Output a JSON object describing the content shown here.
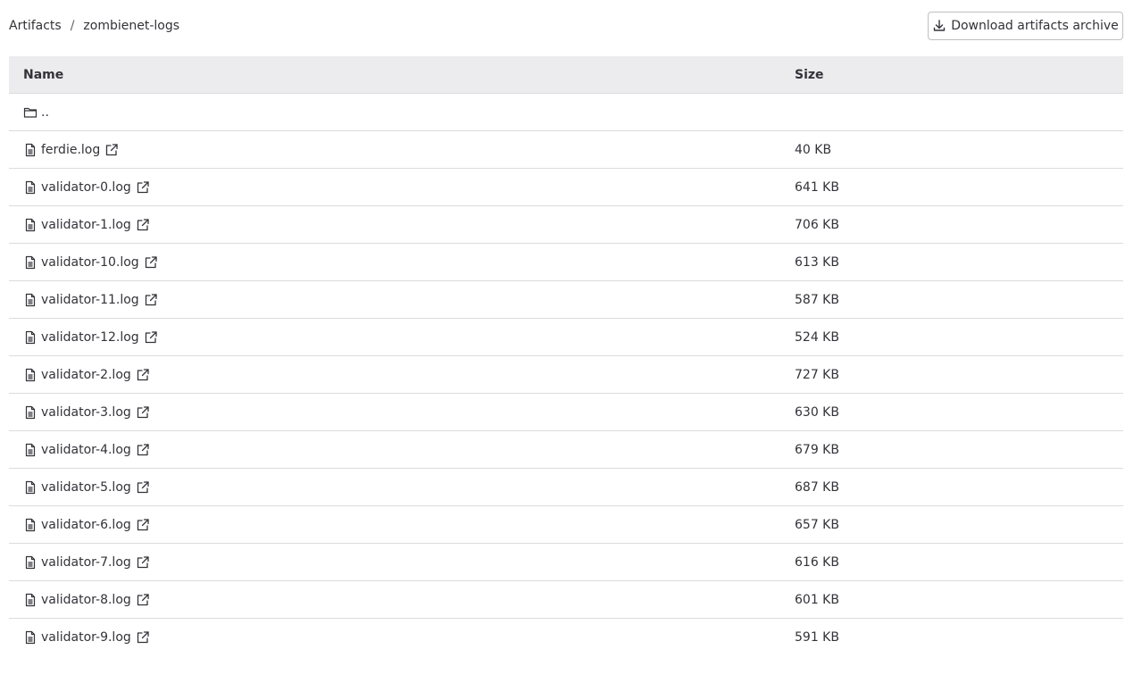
{
  "breadcrumb": {
    "root": "Artifacts",
    "separator": "/",
    "current": "zombienet-logs"
  },
  "toolbar": {
    "download_label": "Download artifacts archive"
  },
  "table": {
    "headers": {
      "name": "Name",
      "size": "Size"
    },
    "parent": {
      "label": "..",
      "icon": "folder-icon"
    },
    "rows": [
      {
        "name": "ferdie.log",
        "size": "40 KB"
      },
      {
        "name": "validator-0.log",
        "size": "641 KB"
      },
      {
        "name": "validator-1.log",
        "size": "706 KB"
      },
      {
        "name": "validator-10.log",
        "size": "613 KB"
      },
      {
        "name": "validator-11.log",
        "size": "587 KB"
      },
      {
        "name": "validator-12.log",
        "size": "524 KB"
      },
      {
        "name": "validator-2.log",
        "size": "727 KB"
      },
      {
        "name": "validator-3.log",
        "size": "630 KB"
      },
      {
        "name": "validator-4.log",
        "size": "679 KB"
      },
      {
        "name": "validator-5.log",
        "size": "687 KB"
      },
      {
        "name": "validator-6.log",
        "size": "657 KB"
      },
      {
        "name": "validator-7.log",
        "size": "616 KB"
      },
      {
        "name": "validator-8.log",
        "size": "601 KB"
      },
      {
        "name": "validator-9.log",
        "size": "591 KB"
      }
    ]
  },
  "colors": {
    "text": "#333238",
    "header_bg": "#ececef",
    "border": "#dcdcde"
  }
}
